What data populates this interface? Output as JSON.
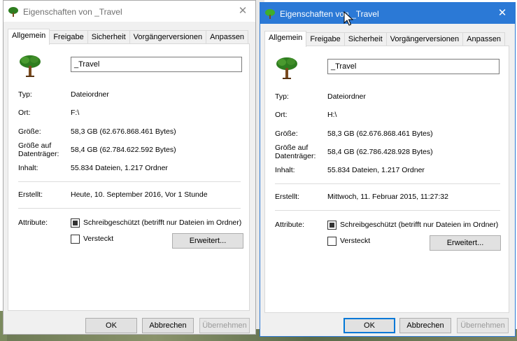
{
  "dialogs": [
    {
      "title": "Eigenschaften von _Travel",
      "close_glyph": "✕",
      "tabs": [
        "Allgemein",
        "Freigabe",
        "Sicherheit",
        "Vorgängerversionen",
        "Anpassen"
      ],
      "active_tab": "Allgemein",
      "name": "_Travel",
      "props": {
        "typ_label": "Typ:",
        "typ_value": "Dateiordner",
        "ort_label": "Ort:",
        "ort_value": "F:\\",
        "groesse_label": "Größe:",
        "groesse_value": "58,3 GB (62.676.868.461 Bytes)",
        "disk_label_1": "Größe auf",
        "disk_label_2": "Datenträger:",
        "disk_value": "58,4 GB (62.784.622.592 Bytes)",
        "inhalt_label": "Inhalt:",
        "inhalt_value": "55.834 Dateien, 1.217 Ordner",
        "erstellt_label": "Erstellt:",
        "erstellt_value": "Heute, 10. September 2016, Vor 1 Stunde"
      },
      "attributes_label": "Attribute:",
      "readonly_label": "Schreibgeschützt (betrifft nur Dateien im Ordner)",
      "readonly_checked": true,
      "hidden_label": "Versteckt",
      "hidden_checked": false,
      "advanced_button": "Erweitert...",
      "ok_button": "OK",
      "cancel_button": "Abbrechen",
      "apply_button": "Übernehmen"
    },
    {
      "title": "Eigenschaften von _Travel",
      "close_glyph": "✕",
      "tabs": [
        "Allgemein",
        "Freigabe",
        "Sicherheit",
        "Vorgängerversionen",
        "Anpassen"
      ],
      "active_tab": "Allgemein",
      "name": "_Travel",
      "props": {
        "typ_label": "Typ:",
        "typ_value": "Dateiordner",
        "ort_label": "Ort:",
        "ort_value": "H:\\",
        "groesse_label": "Größe:",
        "groesse_value": "58,3 GB (62.676.868.461 Bytes)",
        "disk_label_1": "Größe auf",
        "disk_label_2": "Datenträger:",
        "disk_value": "58,4 GB (62.786.428.928 Bytes)",
        "inhalt_label": "Inhalt:",
        "inhalt_value": "55.834 Dateien, 1.217 Ordner",
        "erstellt_label": "Erstellt:",
        "erstellt_value": "Mittwoch, 11. Februar 2015, 11:27:32"
      },
      "attributes_label": "Attribute:",
      "readonly_label": "Schreibgeschützt (betrifft nur Dateien im Ordner)",
      "readonly_checked": true,
      "hidden_label": "Versteckt",
      "hidden_checked": false,
      "advanced_button": "Erweitert...",
      "ok_button": "OK",
      "cancel_button": "Abbrechen",
      "apply_button": "Übernehmen"
    }
  ],
  "colors": {
    "active_titlebar": "#2b79d6",
    "focus_border": "#0078d7",
    "dialog_bg": "#f0f0f0",
    "tree_foliage": "#2e7d1f",
    "tree_trunk": "#7a4a1e"
  },
  "icons": [
    "tree-folder-icon",
    "close-icon",
    "mouse-cursor-icon"
  ]
}
